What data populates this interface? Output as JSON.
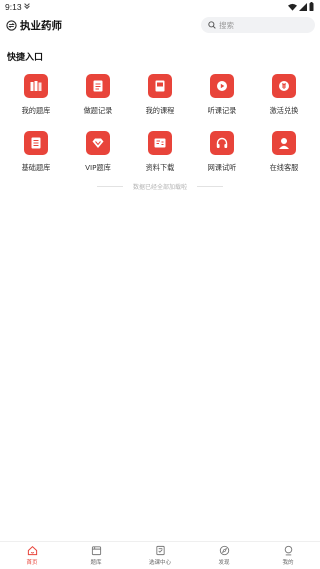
{
  "status_bar": {
    "time": "9:13"
  },
  "header": {
    "app_title": "执业药师",
    "search_placeholder": "搜索"
  },
  "quick_access": {
    "title": "快捷入口",
    "items": [
      {
        "label": "我的题库",
        "icon": "books-icon"
      },
      {
        "label": "做题记录",
        "icon": "notes-icon"
      },
      {
        "label": "我的课程",
        "icon": "course-book-icon"
      },
      {
        "label": "听课记录",
        "icon": "play-record-icon"
      },
      {
        "label": "激活兑换",
        "icon": "coin-exchange-icon"
      },
      {
        "label": "基础题库",
        "icon": "document-icon"
      },
      {
        "label": "VIP题库",
        "icon": "vip-diamond-icon"
      },
      {
        "label": "资料下载",
        "icon": "download-materials-icon"
      },
      {
        "label": "网课试听",
        "icon": "headphones-icon"
      },
      {
        "label": "在线客服",
        "icon": "customer-service-icon"
      }
    ]
  },
  "end_text": "数据已经全部加载啦",
  "tabbar": {
    "items": [
      {
        "label": "首页",
        "icon": "home-icon",
        "active": true
      },
      {
        "label": "题库",
        "icon": "question-bank-icon",
        "active": false
      },
      {
        "label": "选课中心",
        "icon": "course-center-icon",
        "active": false
      },
      {
        "label": "发现",
        "icon": "compass-icon",
        "active": false
      },
      {
        "label": "我的",
        "icon": "profile-icon",
        "active": false
      }
    ]
  },
  "colors": {
    "accent": "#e8443a",
    "search_bg": "#f1f2f4"
  }
}
